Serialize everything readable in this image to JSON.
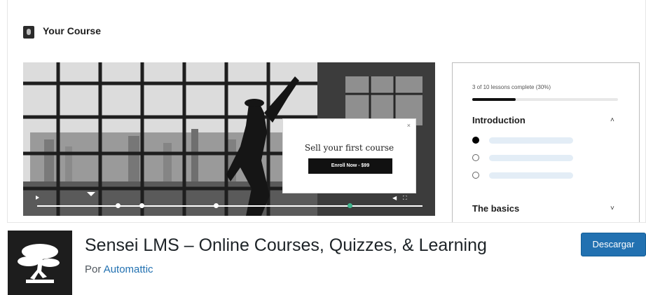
{
  "banner": {
    "section_title": "Your Course",
    "popup": {
      "title": "Sell your first course",
      "button_label": "Enroll Now - $99",
      "close_glyph": "×"
    },
    "player": {
      "play_icon": "play-icon",
      "volume_glyph": "◀",
      "fullscreen_glyph": "⛶"
    },
    "sidebar": {
      "progress_text": "3 of 10 lessons complete (30%)",
      "progress_fraction": 0.3,
      "modules": [
        {
          "title": "Introduction",
          "chevron": "˄"
        },
        {
          "title": "The basics",
          "chevron": "˅"
        }
      ]
    }
  },
  "plugin": {
    "title": "Sensei LMS – Online Courses, Quizzes, & Learning",
    "author_prefix": "Por",
    "author_name": "Automattic",
    "download_label": "Descargar"
  },
  "colors": {
    "accent": "#2271b1",
    "scrub_active": "#3fb58d"
  }
}
